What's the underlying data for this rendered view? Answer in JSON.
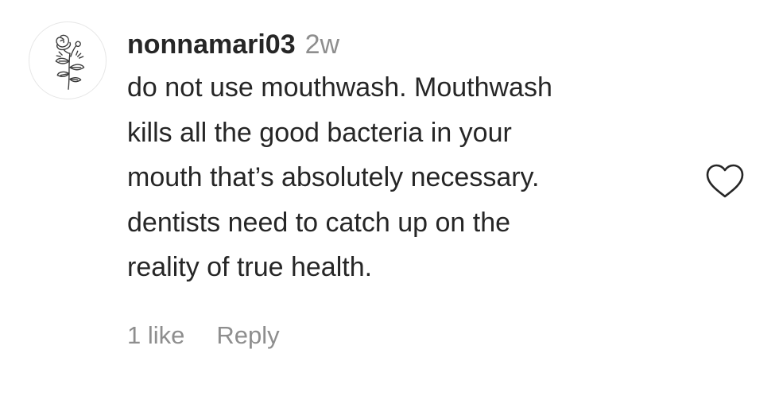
{
  "comment": {
    "username": "nonnamari03",
    "timestamp": "2w",
    "text_lines": [
      "do not use mouthwash. Mouthwash",
      "kills all the good bacteria in your",
      "mouth that’s absolutely necessary.",
      "dentists need to catch up on the",
      "reality of true health."
    ],
    "likes_label": "1 like",
    "reply_label": "Reply",
    "avatar_icon": "rose-sketch-icon",
    "like_icon": "heart-outline-icon"
  },
  "colors": {
    "text": "#262626",
    "muted": "#8e8e8e",
    "border": "#e6e6e6"
  }
}
